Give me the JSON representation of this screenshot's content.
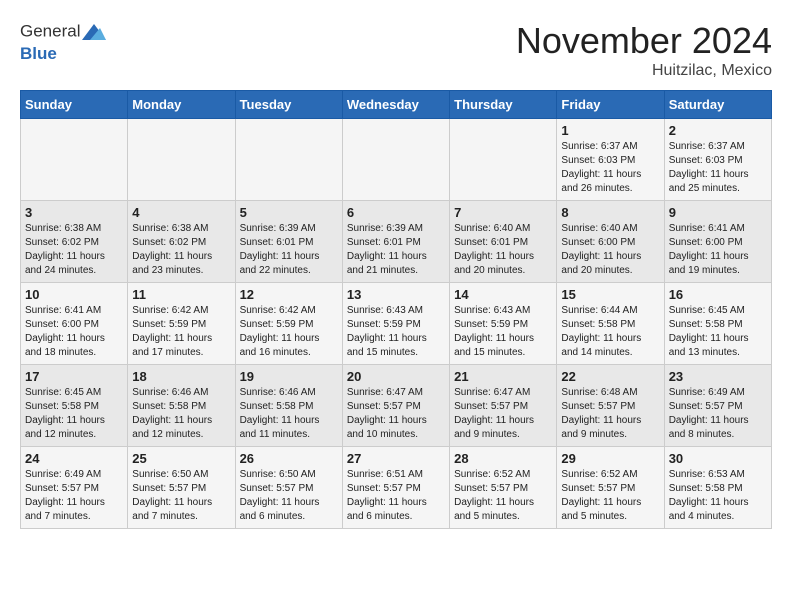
{
  "header": {
    "logo_line1": "General",
    "logo_line2": "Blue",
    "month": "November 2024",
    "location": "Huitzilac, Mexico"
  },
  "days_of_week": [
    "Sunday",
    "Monday",
    "Tuesday",
    "Wednesday",
    "Thursday",
    "Friday",
    "Saturday"
  ],
  "weeks": [
    [
      {
        "day": "",
        "info": ""
      },
      {
        "day": "",
        "info": ""
      },
      {
        "day": "",
        "info": ""
      },
      {
        "day": "",
        "info": ""
      },
      {
        "day": "",
        "info": ""
      },
      {
        "day": "1",
        "info": "Sunrise: 6:37 AM\nSunset: 6:03 PM\nDaylight: 11 hours and 26 minutes."
      },
      {
        "day": "2",
        "info": "Sunrise: 6:37 AM\nSunset: 6:03 PM\nDaylight: 11 hours and 25 minutes."
      }
    ],
    [
      {
        "day": "3",
        "info": "Sunrise: 6:38 AM\nSunset: 6:02 PM\nDaylight: 11 hours and 24 minutes."
      },
      {
        "day": "4",
        "info": "Sunrise: 6:38 AM\nSunset: 6:02 PM\nDaylight: 11 hours and 23 minutes."
      },
      {
        "day": "5",
        "info": "Sunrise: 6:39 AM\nSunset: 6:01 PM\nDaylight: 11 hours and 22 minutes."
      },
      {
        "day": "6",
        "info": "Sunrise: 6:39 AM\nSunset: 6:01 PM\nDaylight: 11 hours and 21 minutes."
      },
      {
        "day": "7",
        "info": "Sunrise: 6:40 AM\nSunset: 6:01 PM\nDaylight: 11 hours and 20 minutes."
      },
      {
        "day": "8",
        "info": "Sunrise: 6:40 AM\nSunset: 6:00 PM\nDaylight: 11 hours and 20 minutes."
      },
      {
        "day": "9",
        "info": "Sunrise: 6:41 AM\nSunset: 6:00 PM\nDaylight: 11 hours and 19 minutes."
      }
    ],
    [
      {
        "day": "10",
        "info": "Sunrise: 6:41 AM\nSunset: 6:00 PM\nDaylight: 11 hours and 18 minutes."
      },
      {
        "day": "11",
        "info": "Sunrise: 6:42 AM\nSunset: 5:59 PM\nDaylight: 11 hours and 17 minutes."
      },
      {
        "day": "12",
        "info": "Sunrise: 6:42 AM\nSunset: 5:59 PM\nDaylight: 11 hours and 16 minutes."
      },
      {
        "day": "13",
        "info": "Sunrise: 6:43 AM\nSunset: 5:59 PM\nDaylight: 11 hours and 15 minutes."
      },
      {
        "day": "14",
        "info": "Sunrise: 6:43 AM\nSunset: 5:59 PM\nDaylight: 11 hours and 15 minutes."
      },
      {
        "day": "15",
        "info": "Sunrise: 6:44 AM\nSunset: 5:58 PM\nDaylight: 11 hours and 14 minutes."
      },
      {
        "day": "16",
        "info": "Sunrise: 6:45 AM\nSunset: 5:58 PM\nDaylight: 11 hours and 13 minutes."
      }
    ],
    [
      {
        "day": "17",
        "info": "Sunrise: 6:45 AM\nSunset: 5:58 PM\nDaylight: 11 hours and 12 minutes."
      },
      {
        "day": "18",
        "info": "Sunrise: 6:46 AM\nSunset: 5:58 PM\nDaylight: 11 hours and 12 minutes."
      },
      {
        "day": "19",
        "info": "Sunrise: 6:46 AM\nSunset: 5:58 PM\nDaylight: 11 hours and 11 minutes."
      },
      {
        "day": "20",
        "info": "Sunrise: 6:47 AM\nSunset: 5:57 PM\nDaylight: 11 hours and 10 minutes."
      },
      {
        "day": "21",
        "info": "Sunrise: 6:47 AM\nSunset: 5:57 PM\nDaylight: 11 hours and 9 minutes."
      },
      {
        "day": "22",
        "info": "Sunrise: 6:48 AM\nSunset: 5:57 PM\nDaylight: 11 hours and 9 minutes."
      },
      {
        "day": "23",
        "info": "Sunrise: 6:49 AM\nSunset: 5:57 PM\nDaylight: 11 hours and 8 minutes."
      }
    ],
    [
      {
        "day": "24",
        "info": "Sunrise: 6:49 AM\nSunset: 5:57 PM\nDaylight: 11 hours and 7 minutes."
      },
      {
        "day": "25",
        "info": "Sunrise: 6:50 AM\nSunset: 5:57 PM\nDaylight: 11 hours and 7 minutes."
      },
      {
        "day": "26",
        "info": "Sunrise: 6:50 AM\nSunset: 5:57 PM\nDaylight: 11 hours and 6 minutes."
      },
      {
        "day": "27",
        "info": "Sunrise: 6:51 AM\nSunset: 5:57 PM\nDaylight: 11 hours and 6 minutes."
      },
      {
        "day": "28",
        "info": "Sunrise: 6:52 AM\nSunset: 5:57 PM\nDaylight: 11 hours and 5 minutes."
      },
      {
        "day": "29",
        "info": "Sunrise: 6:52 AM\nSunset: 5:57 PM\nDaylight: 11 hours and 5 minutes."
      },
      {
        "day": "30",
        "info": "Sunrise: 6:53 AM\nSunset: 5:58 PM\nDaylight: 11 hours and 4 minutes."
      }
    ]
  ]
}
